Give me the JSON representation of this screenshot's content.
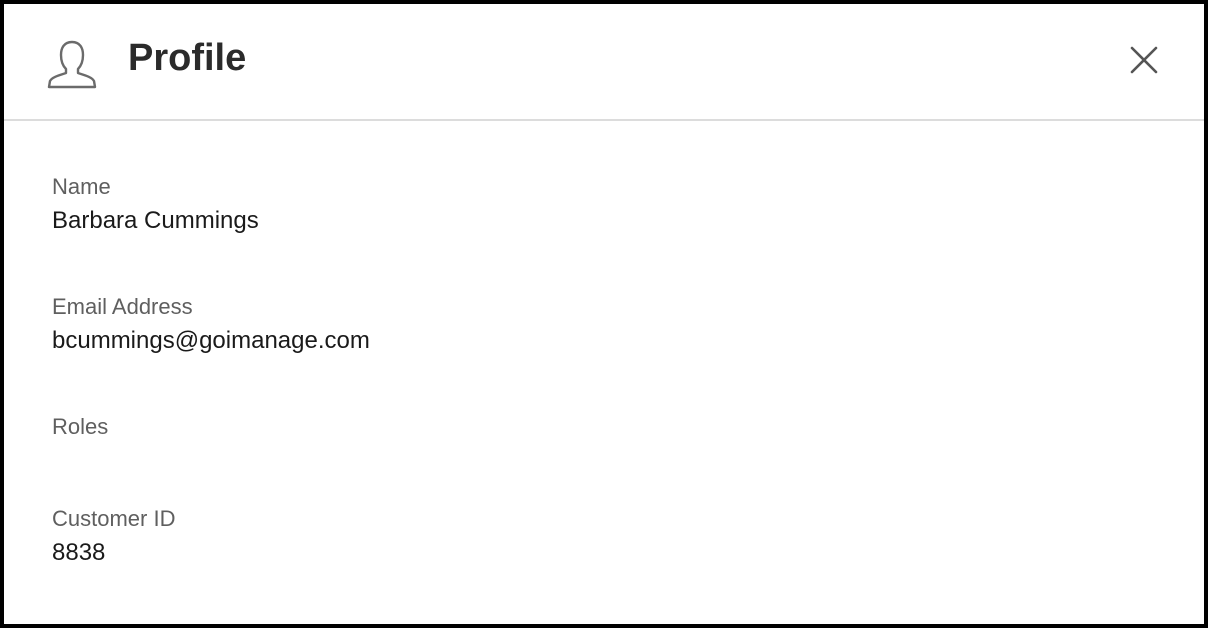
{
  "dialog": {
    "title": "Profile",
    "header_icon": "user-profile-icon",
    "close_icon": "close-icon"
  },
  "fields": {
    "name": {
      "label": "Name",
      "value": "Barbara Cummings"
    },
    "email": {
      "label": "Email Address",
      "value": "bcummings@goimanage.com"
    },
    "roles": {
      "label": "Roles",
      "value": ""
    },
    "customer_id": {
      "label": "Customer ID",
      "value": "8838"
    }
  },
  "colors": {
    "background": "#ffffff",
    "label": "#5f5f5f",
    "value": "#1a1a1a",
    "title": "#2b2b2b",
    "divider": "#dcdcdc",
    "icon": "#6b6b6b"
  }
}
